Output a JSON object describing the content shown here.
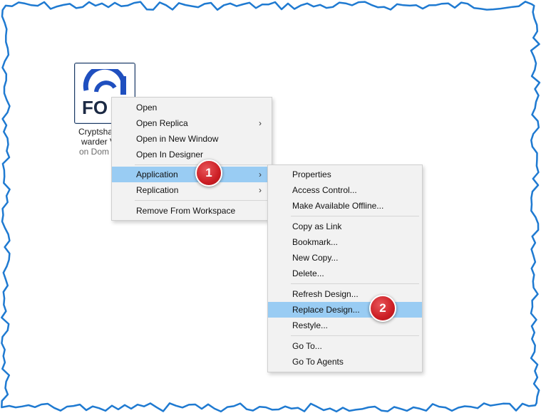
{
  "database": {
    "logo_text": "FO",
    "title_line1": "Cryptsha",
    "title_line2": "warder V",
    "server_line": "on Dom"
  },
  "context_menu": {
    "items": [
      {
        "label": "Open"
      },
      {
        "label": "Open Replica",
        "submenu": true
      },
      {
        "label": "Open in New Window"
      },
      {
        "label": "Open In Designer"
      },
      {
        "label": "Application",
        "submenu": true,
        "highlighted": true
      },
      {
        "label": "Replication",
        "submenu": true
      },
      {
        "label": "Remove From Workspace"
      }
    ]
  },
  "application_submenu": {
    "items": [
      {
        "label": "Properties"
      },
      {
        "label": "Access Control..."
      },
      {
        "label": "Make Available Offline..."
      },
      {
        "label": "Copy as Link"
      },
      {
        "label": "Bookmark..."
      },
      {
        "label": "New Copy..."
      },
      {
        "label": "Delete..."
      },
      {
        "label": "Refresh Design..."
      },
      {
        "label": "Replace Design...",
        "highlighted": true
      },
      {
        "label": "Restyle..."
      },
      {
        "label": "Go To..."
      },
      {
        "label": "Go To Agents"
      }
    ]
  },
  "step_badges": [
    "1",
    "2"
  ],
  "chevron_glyph": "›",
  "colors": {
    "highlight": "#99ccf3",
    "badge": "#cc1e24",
    "frame": "#1f7ad1",
    "logo_blue": "#1f4fbf",
    "logo_text": "#1c2a44"
  },
  "icons": {
    "database_icon": "application-logo-icon",
    "submenu_arrow": "chevron-right-icon"
  }
}
